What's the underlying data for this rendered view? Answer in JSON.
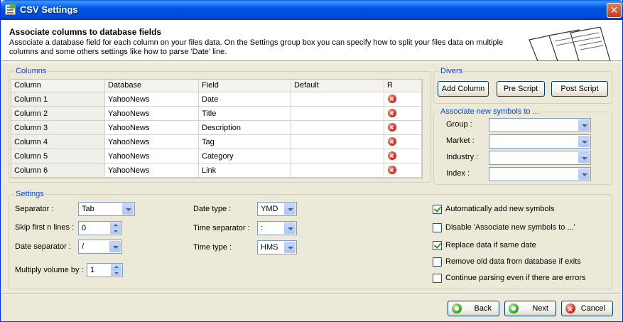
{
  "window": {
    "title": "CSV Settings",
    "close_glyph": "✕"
  },
  "header": {
    "title": "Associate columns to database fields",
    "description": "Associate a database field for each column on your files data. On the Settings group box you can specify how to split your files data on multiple columns and some others settings like how to parse 'Date' line."
  },
  "columns_group": {
    "legend": "Columns",
    "headers": [
      "Column",
      "Database",
      "Field",
      "Default",
      "R"
    ],
    "rows": [
      {
        "column": "Column 1",
        "database": "YahooNews",
        "field": "Date",
        "default": ""
      },
      {
        "column": "Column 2",
        "database": "YahooNews",
        "field": "Title",
        "default": ""
      },
      {
        "column": "Column 3",
        "database": "YahooNews",
        "field": "Description",
        "default": ""
      },
      {
        "column": "Column 4",
        "database": "YahooNews",
        "field": "Tag",
        "default": ""
      },
      {
        "column": "Column 5",
        "database": "YahooNews",
        "field": "Category",
        "default": ""
      },
      {
        "column": "Column 6",
        "database": "YahooNews",
        "field": "Link",
        "default": ""
      }
    ],
    "row_remove_icon": "remove-icon"
  },
  "divers_group": {
    "legend": "Divers",
    "add_column_label": "Add Column",
    "pre_script_label": "Pre Script",
    "post_script_label": "Post Script"
  },
  "symbols_group": {
    "legend": "Associate new symbols to ...",
    "group_label": "Group :",
    "market_label": "Market :",
    "industry_label": "Industry :",
    "index_label": "Index :",
    "group_value": "",
    "market_value": "",
    "industry_value": "",
    "index_value": ""
  },
  "settings_group": {
    "legend": "Settings",
    "separator_label": "Separator :",
    "separator_value": "Tab",
    "skip_lines_label": "Skip first n lines :",
    "skip_lines_value": "0",
    "date_separator_label": "Date separator :",
    "date_separator_value": "/",
    "multiply_volume_label": "Multiply volume by :",
    "multiply_volume_value": "1",
    "date_type_label": "Date type :",
    "date_type_value": "YMD",
    "time_separator_label": "Time separator :",
    "time_separator_value": ":",
    "time_type_label": "Time type :",
    "time_type_value": "HMS",
    "checkboxes": [
      {
        "label": "Automatically add new symbols",
        "checked": true
      },
      {
        "label": "Disable 'Associate new symbols to ...'",
        "checked": false
      },
      {
        "label": "Replace data if same date",
        "checked": true
      },
      {
        "label": "Remove old data from database if exits",
        "checked": false
      },
      {
        "label": "Continue parsing even if there are errors",
        "checked": false
      }
    ]
  },
  "footer": {
    "back_label": "Back",
    "next_label": "Next",
    "cancel_label": "Cancel"
  }
}
